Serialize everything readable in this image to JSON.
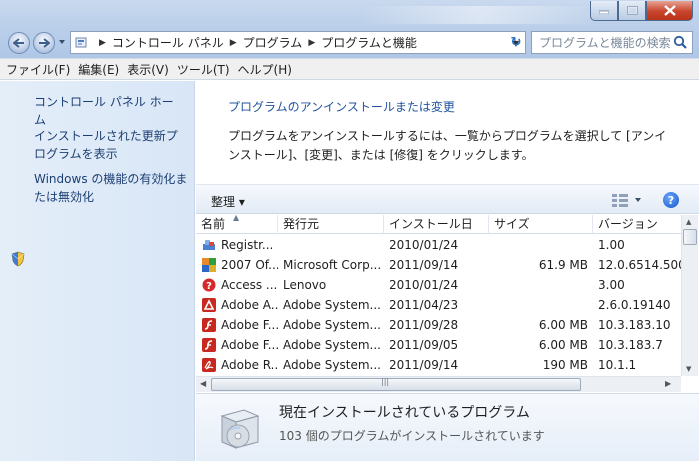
{
  "window": {
    "breadcrumbs": [
      "コントロール パネル",
      "プログラム",
      "プログラムと機能"
    ],
    "search_placeholder": "プログラムと機能の検索"
  },
  "menu": [
    "ファイル(F)",
    "編集(E)",
    "表示(V)",
    "ツール(T)",
    "ヘルプ(H)"
  ],
  "sidebar": {
    "items": [
      {
        "label": "コントロール パネル ホーム"
      },
      {
        "label": "インストールされた更新プログラムを表示"
      },
      {
        "label": "Windows の機能の有効化または無効化"
      }
    ]
  },
  "main": {
    "heading": "プログラムのアンインストールまたは変更",
    "description": "プログラムをアンインストールするには、一覧からプログラムを選択して [アンインストール]、[変更]、または [修復] をクリックします。",
    "toolbar": {
      "organize": "整理 ▾",
      "views_icon": "views-icon",
      "help_icon": "help-icon"
    }
  },
  "table": {
    "columns": [
      "名前",
      "発行元",
      "インストール日",
      "サイズ",
      "バージョン"
    ],
    "rows": [
      {
        "icon": "registry-icon",
        "name": "Registr...",
        "publisher": "",
        "date": "2010/01/24",
        "size": "",
        "version": "1.00"
      },
      {
        "icon": "office-icon",
        "name": "2007 Of...",
        "publisher": "Microsoft Corp...",
        "date": "2011/09/14",
        "size": "61.9 MB",
        "version": "12.0.6514.500"
      },
      {
        "icon": "help-red-icon",
        "name": "Access ...",
        "publisher": "Lenovo",
        "date": "2010/01/24",
        "size": "",
        "version": "3.00"
      },
      {
        "icon": "adobe-air-icon",
        "name": "Adobe A...",
        "publisher": "Adobe System...",
        "date": "2011/04/23",
        "size": "",
        "version": "2.6.0.19140"
      },
      {
        "icon": "adobe-flash-icon",
        "name": "Adobe F...",
        "publisher": "Adobe System...",
        "date": "2011/09/28",
        "size": "6.00 MB",
        "version": "10.3.183.10"
      },
      {
        "icon": "adobe-flash-icon",
        "name": "Adobe F...",
        "publisher": "Adobe System...",
        "date": "2011/09/05",
        "size": "6.00 MB",
        "version": "10.3.183.7"
      },
      {
        "icon": "adobe-reader-icon",
        "name": "Adobe R...",
        "publisher": "Adobe System...",
        "date": "2011/09/14",
        "size": "190 MB",
        "version": "10.1.1"
      }
    ]
  },
  "details": {
    "title": "現在インストールされているプログラム",
    "count_text": "103 個のプログラムがインストールされています"
  },
  "colors": {
    "link": "#1c3f73",
    "heading": "#2253a0",
    "close": "#c8452c"
  }
}
